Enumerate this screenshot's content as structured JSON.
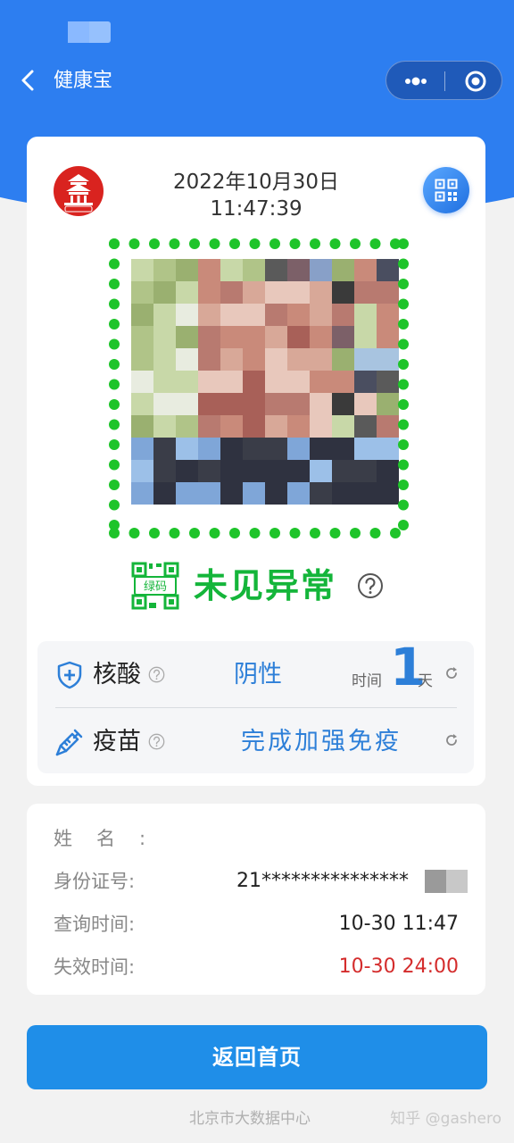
{
  "header": {
    "title": "健康宝",
    "back_icon": "chevron-left-icon",
    "more_icon": "more-dots-icon",
    "close_icon": "target-circle-icon"
  },
  "card": {
    "logo_text": "北京健康宝",
    "date": "2022年10月30日",
    "time": "11:47:39",
    "code_badge": "绿码",
    "status": "未见异常",
    "status_color": "#14b53a",
    "nucleic": {
      "label": "核酸",
      "value": "阴性",
      "time_label": "时间",
      "time_value": "1",
      "time_unit": "天"
    },
    "vaccine": {
      "label": "疫苗",
      "value": "完成加强免疫"
    }
  },
  "personal": {
    "name_label": "姓名:",
    "name_value": "",
    "id_label": "身份证号:",
    "id_value": "21***************",
    "query_label": "查询时间:",
    "query_value": "10-30 11:47",
    "expire_label": "失效时间:",
    "expire_value": "10-30 24:00"
  },
  "home_button": "返回首页",
  "footer": {
    "source": "北京市大数据中心",
    "watermark": "知乎 @gashero"
  },
  "colors": {
    "brand_blue": "#2d7ef0",
    "button_blue": "#1f8ee8",
    "value_blue": "#2d7fd8",
    "expire_red": "#d42c2c"
  }
}
